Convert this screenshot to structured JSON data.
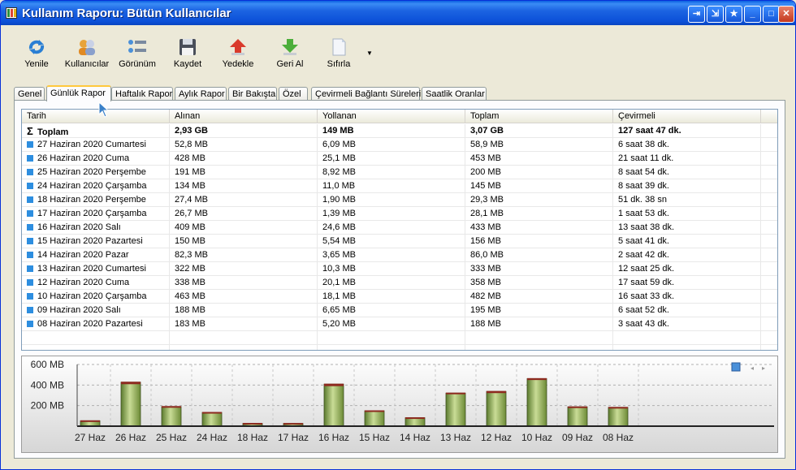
{
  "window": {
    "title": "Kullanım Raporu: Bütün Kullanıcılar"
  },
  "toolbar": {
    "refresh": "Yenile",
    "users": "Kullanıcılar",
    "view": "Görünüm",
    "save": "Kaydet",
    "backup": "Yedekle",
    "restore": "Geri Al",
    "reset": "Sıfırla"
  },
  "tabs": [
    "Genel",
    "Günlük Rapor",
    "Haftalık Rapor",
    "Aylık Rapor",
    "Bir Bakışta",
    "Özel",
    "Çevirmeli Bağlantı Süreleri",
    "Saatlik Oranlar"
  ],
  "table": {
    "headers": [
      "Tarih",
      "Alınan",
      "Yollanan",
      "Toplam",
      "Çevirmeli"
    ],
    "total": [
      "Toplam",
      "2,93 GB",
      "149 MB",
      "3,07 GB",
      "127 saat 47 dk."
    ],
    "rows": [
      [
        "27 Haziran 2020 Cumartesi",
        "52,8 MB",
        "6,09 MB",
        "58,9 MB",
        "6 saat 38 dk."
      ],
      [
        "26 Haziran 2020 Cuma",
        "428 MB",
        "25,1 MB",
        "453 MB",
        "21 saat 11 dk."
      ],
      [
        "25 Haziran 2020 Perşembe",
        "191 MB",
        "8,92 MB",
        "200 MB",
        "8 saat 54 dk."
      ],
      [
        "24 Haziran 2020 Çarşamba",
        "134 MB",
        "11,0 MB",
        "145 MB",
        "8 saat 39 dk."
      ],
      [
        "18 Haziran 2020 Perşembe",
        "27,4 MB",
        "1,90 MB",
        "29,3 MB",
        "51 dk. 38 sn"
      ],
      [
        "17 Haziran 2020 Çarşamba",
        "26,7 MB",
        "1,39 MB",
        "28,1 MB",
        "1 saat 53 dk."
      ],
      [
        "16 Haziran 2020 Salı",
        "409 MB",
        "24,6 MB",
        "433 MB",
        "13 saat 38 dk."
      ],
      [
        "15 Haziran 2020 Pazartesi",
        "150 MB",
        "5,54 MB",
        "156 MB",
        "5 saat 41 dk."
      ],
      [
        "14 Haziran 2020 Pazar",
        "82,3 MB",
        "3,65 MB",
        "86,0 MB",
        "2 saat 42 dk."
      ],
      [
        "13 Haziran 2020 Cumartesi",
        "322 MB",
        "10,3 MB",
        "333 MB",
        "12 saat 25 dk."
      ],
      [
        "12 Haziran 2020 Cuma",
        "338 MB",
        "20,1 MB",
        "358 MB",
        "17 saat 59 dk."
      ],
      [
        "10 Haziran 2020 Çarşamba",
        "463 MB",
        "18,1 MB",
        "482 MB",
        "16 saat 33 dk."
      ],
      [
        "09 Haziran 2020 Salı",
        "188 MB",
        "6,65 MB",
        "195 MB",
        "6 saat 52 dk."
      ],
      [
        "08 Haziran 2020 Pazartesi",
        "183 MB",
        "5,20 MB",
        "188 MB",
        "3 saat 43 dk."
      ]
    ]
  },
  "chart_data": {
    "type": "bar",
    "categories": [
      "27 Haz",
      "26 Haz",
      "25 Haz",
      "24 Haz",
      "18 Haz",
      "17 Haz",
      "16 Haz",
      "15 Haz",
      "14 Haz",
      "13 Haz",
      "12 Haz",
      "10 Haz",
      "09 Haz",
      "08 Haz"
    ],
    "series": [
      {
        "values": [
          52.8,
          428,
          191,
          134,
          27.4,
          26.7,
          409,
          150,
          82.3,
          322,
          338,
          463,
          188,
          183
        ]
      },
      {
        "values": [
          6.09,
          25.1,
          8.92,
          11.0,
          1.9,
          1.39,
          24.6,
          5.54,
          3.65,
          10.3,
          20.1,
          18.1,
          6.65,
          5.2
        ]
      }
    ],
    "yticks": [
      "200 MB",
      "400 MB",
      "600 MB"
    ],
    "ytick_values": [
      200,
      400,
      600
    ],
    "ylim": [
      0,
      600
    ],
    "grid": true,
    "colors": {
      "received": "#8aa657",
      "sent": "#c0392b"
    }
  }
}
